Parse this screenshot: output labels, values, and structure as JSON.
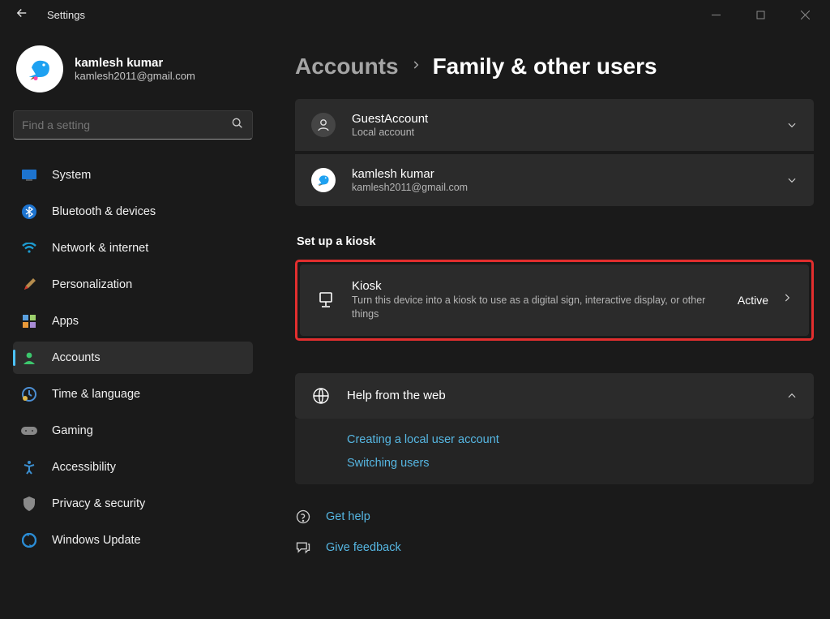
{
  "window": {
    "title": "Settings"
  },
  "profile": {
    "name": "kamlesh kumar",
    "email": "kamlesh2011@gmail.com"
  },
  "search": {
    "placeholder": "Find a setting"
  },
  "nav": [
    {
      "label": "System"
    },
    {
      "label": "Bluetooth & devices"
    },
    {
      "label": "Network & internet"
    },
    {
      "label": "Personalization"
    },
    {
      "label": "Apps"
    },
    {
      "label": "Accounts"
    },
    {
      "label": "Time & language"
    },
    {
      "label": "Gaming"
    },
    {
      "label": "Accessibility"
    },
    {
      "label": "Privacy & security"
    },
    {
      "label": "Windows Update"
    }
  ],
  "breadcrumb": {
    "parent": "Accounts",
    "current": "Family & other users"
  },
  "users": [
    {
      "name": "GuestAccount",
      "sub": "Local account"
    },
    {
      "name": "kamlesh kumar",
      "sub": "kamlesh2011@gmail.com"
    }
  ],
  "kiosk_section": {
    "heading": "Set up a kiosk",
    "title": "Kiosk",
    "desc": "Turn this device into a kiosk to use as a digital sign, interactive display, or other things",
    "status": "Active"
  },
  "help": {
    "title": "Help from the web",
    "links": [
      "Creating a local user account",
      "Switching users"
    ]
  },
  "footer": {
    "help": "Get help",
    "feedback": "Give feedback"
  }
}
